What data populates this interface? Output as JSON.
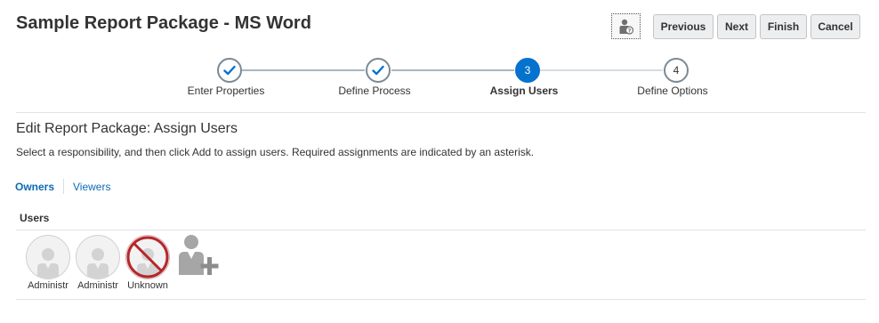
{
  "header": {
    "title": "Sample Report Package - MS Word",
    "help_icon": "user-help-icon",
    "buttons": {
      "previous": "Previous",
      "next": "Next",
      "finish": "Finish",
      "cancel": "Cancel"
    }
  },
  "train": {
    "steps": [
      {
        "label": "Enter Properties",
        "state": "complete",
        "marker": "✓"
      },
      {
        "label": "Define Process",
        "state": "complete",
        "marker": "✓"
      },
      {
        "label": "Assign Users",
        "state": "current",
        "marker": "3"
      },
      {
        "label": "Define Options",
        "state": "future",
        "marker": "4"
      }
    ]
  },
  "main": {
    "section_title": "Edit Report Package: Assign Users",
    "instructions": "Select a responsibility, and then click Add to assign users. Required assignments are indicated by an asterisk.",
    "tabs": [
      {
        "label": "Owners",
        "active": true
      },
      {
        "label": "Viewers",
        "active": false
      }
    ],
    "users_header": "Users",
    "users": [
      {
        "name": "Administr",
        "status": "valid"
      },
      {
        "name": "Administr",
        "status": "valid"
      },
      {
        "name": "Unknown",
        "status": "invalid"
      }
    ],
    "add_user_icon": "add-user-icon"
  },
  "colors": {
    "accent": "#0572ce",
    "link": "#0b6bb8",
    "invalid": "#b5262b"
  }
}
